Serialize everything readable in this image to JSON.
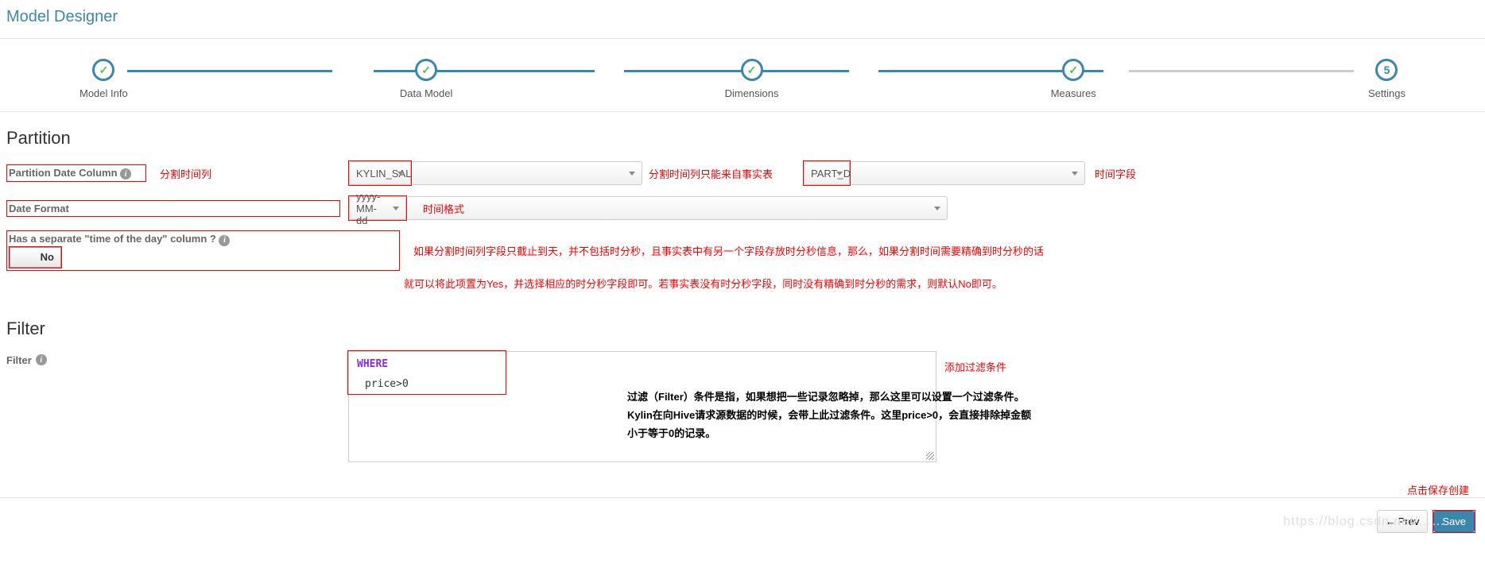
{
  "page_title": "Model Designer",
  "stepper": {
    "steps": [
      {
        "label": "Model Info",
        "state": "done"
      },
      {
        "label": "Data Model",
        "state": "done"
      },
      {
        "label": "Dimensions",
        "state": "done"
      },
      {
        "label": "Measures",
        "state": "done"
      },
      {
        "label": "Settings",
        "state": "current",
        "num": "5"
      }
    ]
  },
  "partition": {
    "title": "Partition",
    "date_column_label": "Partition Date Column",
    "date_column_anno": "分割时间列",
    "table_value": "KYLIN_SALES",
    "table_anno": "分割时间列只能来自事实表",
    "column_value": "PART_DT",
    "column_anno": "时间字段",
    "date_format_label": "Date Format",
    "date_format_value": "yyyy-MM-dd",
    "date_format_anno": "时间格式",
    "separate_time_label": "Has a separate \"time of the day\" column ?",
    "separate_time_value": "No",
    "separate_time_anno1": "如果分割时间列字段只截止到天，并不包括时分秒，且事实表中有另一个字段存放时分秒信息，那么，如果分割时间需要精确到时分秒的话",
    "separate_time_anno2": "就可以将此项置为Yes，并选择相应的时分秒字段即可。若事实表没有时分秒字段，同时没有精确到时分秒的需求，则默认No即可。"
  },
  "filter": {
    "title": "Filter",
    "label": "Filter",
    "where_kw": "WHERE",
    "value": "price>0",
    "anno": "添加过滤条件",
    "explanation": "过滤（Filter）条件是指，如果想把一些记录忽略掉，那么这里可以设置一个过滤条件。Kylin在向Hive请求源数据的时候，会带上此过滤条件。这里price>0，会直接排除掉金额小于等于0的记录。"
  },
  "footer": {
    "prev_label": "Prev",
    "save_label": "Save",
    "save_anno": "点击保存创建",
    "watermark": "https://blog.csdn.net/……"
  },
  "icons": {
    "check": "✓",
    "info": "i",
    "arrow_left": "←"
  }
}
